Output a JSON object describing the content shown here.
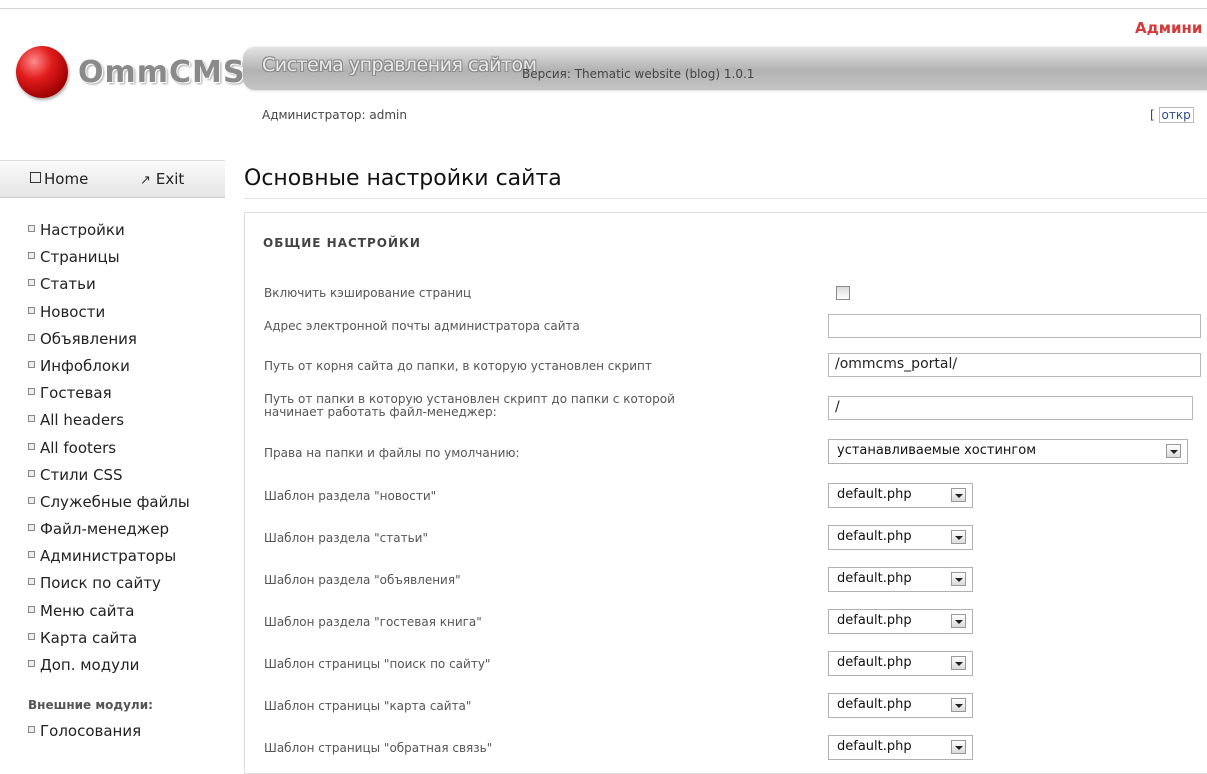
{
  "app": {
    "logo_text": "OmmCMS",
    "admin_link": "Админи",
    "system_title": "Система управления сайтом",
    "version_text": "Версия: Thematic website (blog) 1.0.1",
    "admin_line": "Администратор: admin",
    "open_bracket": "[",
    "open_link": "откр"
  },
  "topnav": {
    "home_label": "Home",
    "exit_label": "Exit"
  },
  "sidebar": {
    "items": [
      {
        "label": "Настройки"
      },
      {
        "label": "Страницы"
      },
      {
        "label": "Статьи"
      },
      {
        "label": "Новости"
      },
      {
        "label": "Объявления"
      },
      {
        "label": "Инфоблоки"
      },
      {
        "label": "Гостевая"
      },
      {
        "label": "All headers"
      },
      {
        "label": "All footers"
      },
      {
        "label": "Стили CSS"
      },
      {
        "label": "Служебные файлы"
      },
      {
        "label": "Файл-менеджер"
      },
      {
        "label": "Администраторы"
      },
      {
        "label": "Поиск по сайту"
      },
      {
        "label": "Меню сайта"
      },
      {
        "label": "Карта сайта"
      },
      {
        "label": "Доп. модули"
      }
    ],
    "external_title": "Внешние модули:",
    "external_items": [
      {
        "label": "Голосования"
      }
    ]
  },
  "main": {
    "page_title": "Основные настройки сайта",
    "section_title": "ОБЩИЕ НАСТРОЙКИ",
    "rows": [
      {
        "label": "Включить кэширование страниц",
        "type": "checkbox",
        "checked": false
      },
      {
        "label": "Адрес электронной почты администратора сайта",
        "type": "text",
        "value": ""
      },
      {
        "label": "Путь от корня сайта до папки, в которую установлен скрипт",
        "type": "text",
        "value": "/ommcms_portal/"
      },
      {
        "label_line1": "Путь от папки в которую установлен скрипт до папки с которой",
        "label_line2": "начинает работать файл-менеджер:",
        "type": "text",
        "value": "/"
      },
      {
        "label": "Права на папки и файлы по умолчанию:",
        "type": "select",
        "value": "устанавливаемые хостингом"
      },
      {
        "label": "Шаблон раздела \"новости\"",
        "type": "select",
        "value": "default.php"
      },
      {
        "label": "Шаблон раздела \"статьи\"",
        "type": "select",
        "value": "default.php"
      },
      {
        "label": "Шаблон раздела \"объявления\"",
        "type": "select",
        "value": "default.php"
      },
      {
        "label": "Шаблон раздела \"гостевая книга\"",
        "type": "select",
        "value": "default.php"
      },
      {
        "label": "Шаблон страницы \"поиск по сайту\"",
        "type": "select",
        "value": "default.php"
      },
      {
        "label": "Шаблон страницы \"карта сайта\"",
        "type": "select",
        "value": "default.php"
      },
      {
        "label": "Шаблон страницы \"обратная связь\"",
        "type": "select",
        "value": "default.php"
      }
    ]
  },
  "colors": {
    "admin_link": "#d43a3a",
    "logo_ball": "#e21d1d",
    "header_bar": "#b2b2b2"
  }
}
